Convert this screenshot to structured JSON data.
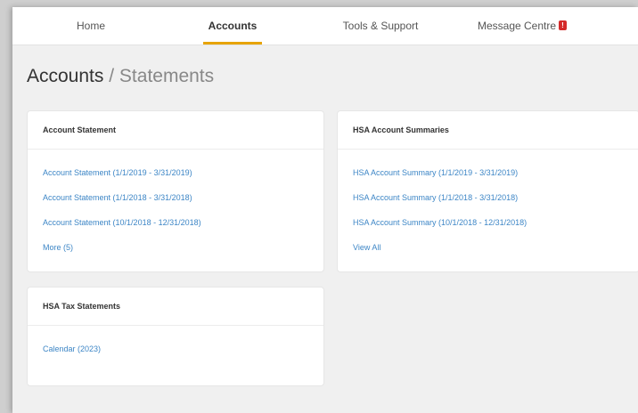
{
  "nav": {
    "items": [
      {
        "label": "Home"
      },
      {
        "label": "Accounts"
      },
      {
        "label": "Tools & Support"
      },
      {
        "label": "Message Centre"
      }
    ],
    "message_badge": "!"
  },
  "breadcrumb": {
    "section": "Accounts",
    "separator": "/",
    "page": "Statements"
  },
  "account_statement": {
    "title": "Account Statement",
    "links": [
      "Account Statement (1/1/2019 - 3/31/2019)",
      "Account Statement (1/1/2018 - 3/31/2018)",
      "Account Statement (10/1/2018 - 12/31/2018)"
    ],
    "more": "More (5)"
  },
  "hsa_summaries": {
    "title": "HSA Account Summaries",
    "links": [
      "HSA Account Summary (1/1/2019 - 3/31/2019)",
      "HSA Account Summary (1/1/2018 - 3/31/2018)",
      "HSA Account Summary (10/1/2018 - 12/31/2018)"
    ],
    "view_all": "View All"
  },
  "hsa_tax": {
    "title": "HSA Tax Statements",
    "links": [
      "Calendar (2023)"
    ]
  },
  "colors": {
    "accent": "#e7a400",
    "link": "#3d86c6",
    "badge": "#d42a2a"
  }
}
